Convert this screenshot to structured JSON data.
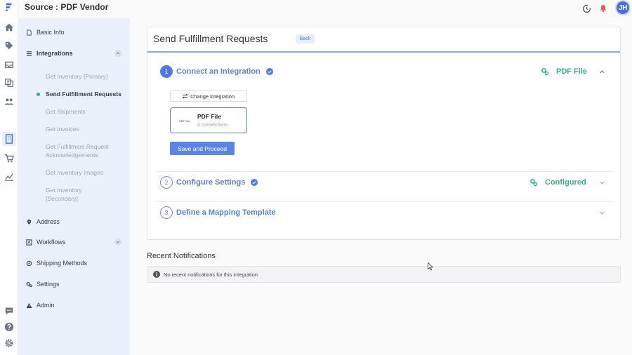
{
  "header": {
    "source_prefix": "Source :",
    "source_name": "PDF Vendor",
    "user_initials": "JH"
  },
  "colors": {
    "accent": "#4c7be4",
    "success": "#33b37e",
    "nav_bg": "#eaf1fb"
  },
  "rail_icons": [
    "logo-icon",
    "home-icon",
    "tag-icon",
    "inbox-icon",
    "copy-icon",
    "users-icon",
    "building-icon",
    "cart-icon",
    "chart-icon",
    "chat-icon",
    "help-icon",
    "gear-icon"
  ],
  "sidebar": {
    "basic_info": "Basic Info",
    "integrations": "Integrations",
    "integration_items": [
      "Get Inventory [Primary]",
      "Send Fulfillment Requests",
      "Get Shipments",
      "Get Invoices",
      "Get Fulfillment Request Acknowledgements",
      "Get Inventory Images",
      "Get Inventory [Secondary]"
    ],
    "address": "Address",
    "workflows": "Workflows",
    "shipping_methods": "Shipping Methods",
    "settings": "Settings",
    "admin": "Admin"
  },
  "main": {
    "title": "Send Fulfillment Requests",
    "back_label": "Back",
    "steps": [
      {
        "num": "1",
        "label": "Connect an Integration",
        "status": "PDF File"
      },
      {
        "num": "2",
        "label": "Configure Settings",
        "status": "Configured"
      },
      {
        "num": "3",
        "label": "Define a Mapping Template",
        "status": ""
      }
    ],
    "change_integration_label": "Change Integration",
    "integration": {
      "logo_text": "PDF File",
      "name": "PDF File",
      "connections": "4 connections"
    },
    "save_label": "Save and Proceed"
  },
  "notifications": {
    "title": "Recent Notifications",
    "empty_text": "No recent notifications for this integration"
  }
}
